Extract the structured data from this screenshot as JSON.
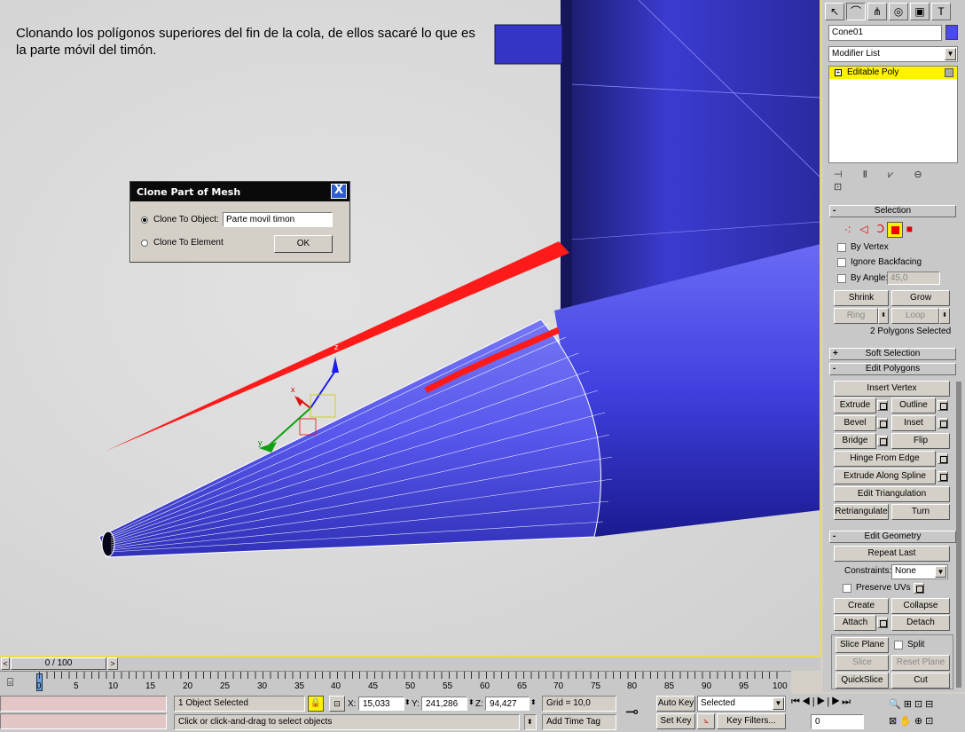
{
  "caption": "Clonando los polígonos superiores del fin de la cola, de ellos sacaré lo que es la parte móvil del timón.",
  "dialog": {
    "title": "Clone Part of Mesh",
    "option_object": "Clone To Object:",
    "object_name": "Parte movil timon",
    "option_element": "Clone To Element",
    "ok": "OK",
    "close": "X"
  },
  "gizmo": {
    "x": "x",
    "y": "y",
    "z": "z"
  },
  "panel": {
    "object_name": "Cone01",
    "modifier_list": "Modifier List",
    "stack_item": "Editable Poly",
    "selection": {
      "title": "Selection",
      "by_vertex": "By Vertex",
      "ignore_backfacing": "Ignore Backfacing",
      "by_angle": "By Angle:",
      "angle_value": "45,0",
      "shrink": "Shrink",
      "grow": "Grow",
      "ring": "Ring",
      "loop": "Loop",
      "status": "2 Polygons Selected"
    },
    "soft_selection": "Soft Selection",
    "edit_polygons": {
      "title": "Edit Polygons",
      "insert_vertex": "Insert Vertex",
      "extrude": "Extrude",
      "outline": "Outline",
      "bevel": "Bevel",
      "inset": "Inset",
      "bridge": "Bridge",
      "flip": "Flip",
      "hinge": "Hinge From Edge",
      "extrude_spline": "Extrude Along Spline",
      "edit_tri": "Edit Triangulation",
      "retriangulate": "Retriangulate",
      "turn": "Turn"
    },
    "edit_geometry": {
      "title": "Edit Geometry",
      "repeat_last": "Repeat Last",
      "constraints": "Constraints:",
      "constraints_value": "None",
      "preserve_uvs": "Preserve UVs",
      "create": "Create",
      "collapse": "Collapse",
      "attach": "Attach",
      "detach": "Detach",
      "slice_plane": "Slice Plane",
      "split": "Split",
      "slice": "Slice",
      "reset_plane": "Reset Plane",
      "quickslice": "QuickSlice",
      "cut": "Cut"
    },
    "colors": {
      "swatch": "#4a4af0",
      "stack_highlight": "#fff200"
    }
  },
  "timeline": {
    "frame": "0 / 100",
    "ticks": [
      "0",
      "5",
      "10",
      "15",
      "20",
      "25",
      "30",
      "35",
      "40",
      "45",
      "50",
      "55",
      "60",
      "65",
      "70",
      "75",
      "80",
      "85",
      "90",
      "95",
      "100"
    ]
  },
  "status": {
    "selected": "1 Object Selected",
    "prompt": "Click or click-and-drag to select objects",
    "x_label": "X:",
    "x": "15,033",
    "y_label": "Y:",
    "y": "241,286",
    "z_label": "Z:",
    "z": "94,427",
    "grid": "Grid = 10,0",
    "add_time_tag": "Add Time Tag",
    "auto_key": "Auto Key",
    "set_key": "Set Key",
    "key_mode": "Selected",
    "key_filters": "Key Filters...",
    "current_frame": "0"
  }
}
